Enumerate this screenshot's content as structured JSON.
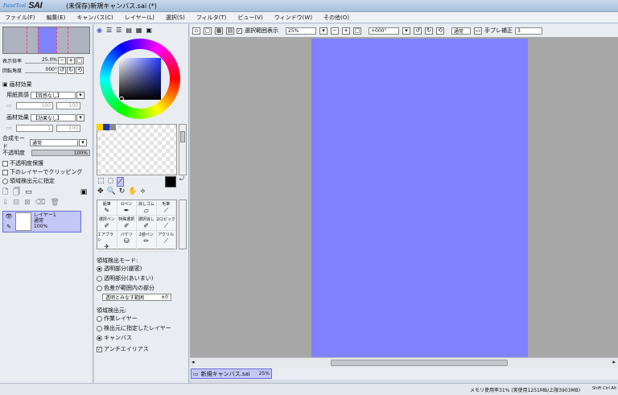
{
  "window": {
    "logo_small": "PaintTool",
    "logo_big": "SAI",
    "title": "(未保存)新規キャンバス.sai (*)"
  },
  "menu": [
    "ファイル(F)",
    "編集(E)",
    "キャンバス(C)",
    "レイヤー(L)",
    "選択(S)",
    "フィルタ(T)",
    "ビュー(V)",
    "ウィンドウ(W)",
    "その他(O)"
  ],
  "navigator": {
    "zoom_label": "表示倍率",
    "zoom_value": "25.0%",
    "angle_label": "回転角度",
    "angle_value": "000°"
  },
  "texture": {
    "section": "画材効果",
    "paper_label": "用紙質感",
    "paper_value": "【質感なし】",
    "paper_scale": "100",
    "paper_strength": "100",
    "effect_label": "画材効果",
    "effect_value": "【効果なし】",
    "effect_width": "1",
    "effect_strength": "100"
  },
  "layer_props": {
    "blend_label": "合成モード",
    "blend_value": "通常",
    "opacity_label": "不透明度",
    "opacity_value": "100%",
    "opt_protect": "不透明度保護",
    "opt_clip": "下のレイヤーでクリッピング",
    "opt_source": "領域検出元に指定"
  },
  "layer": {
    "name": "レイヤー1",
    "mode": "通常",
    "opacity": "100%"
  },
  "tools": [
    {
      "label": "鉛筆",
      "icon": "pencil"
    },
    {
      "label": "Gペン",
      "icon": "pen"
    },
    {
      "label": "消しゴム",
      "icon": "eraser"
    },
    {
      "label": "毛筆",
      "icon": "brush"
    },
    {
      "label": "選択ペン",
      "icon": "select-pen"
    },
    {
      "label": "特殊選択",
      "icon": "special-select"
    },
    {
      "label": "選択消し",
      "icon": "select-erase"
    },
    {
      "label": "2ロピック",
      "icon": "picker"
    },
    {
      "label": "エアブラシ",
      "icon": "airbrush"
    },
    {
      "label": "バケツ",
      "icon": "bucket"
    },
    {
      "label": "2値ペン",
      "icon": "binary-pen"
    },
    {
      "label": "アクリル",
      "icon": "acrylic"
    }
  ],
  "fill_options": {
    "detect_mode_label": "領域検出モード:",
    "modes": [
      "透明部分(厳密)",
      "透明部分(あいまい)",
      "色差が範囲内の部分"
    ],
    "selected_mode": 0,
    "tolerance_label": "透明とみなす範囲",
    "tolerance_value": "±0",
    "source_label": "領域検出元:",
    "sources": [
      "作業レイヤー",
      "検出元に指定したレイヤー",
      "キャンバス"
    ],
    "selected_source": 2,
    "antialias": "アンチエイリアス"
  },
  "canvas_toolbar": {
    "show_selection": "選択範囲表示",
    "zoom": "25%",
    "angle": "+000°",
    "blend": "通常",
    "stabilizer_label": "手ブレ補正",
    "stabilizer_value": "3"
  },
  "doc_tab": {
    "name": "新規キャンバス.sai",
    "zoom": "25%"
  },
  "status": {
    "memory": "メモリ使用率31% (実使用1251MB/上限3903MB)",
    "mode": "Shift Ctrl Alt"
  },
  "colors": {
    "canvas": "#8081ff",
    "workspace": "#a7a7a7",
    "panel": "#e9ecf1"
  }
}
